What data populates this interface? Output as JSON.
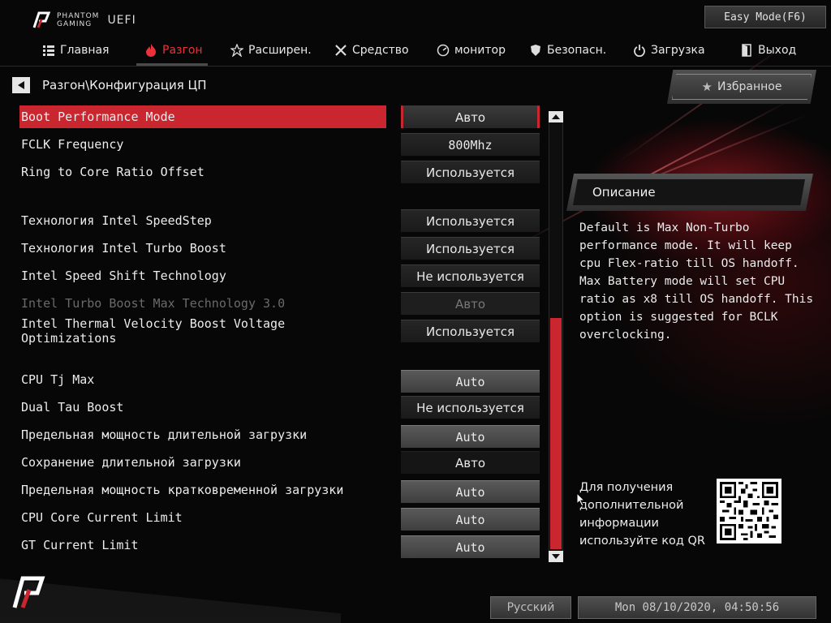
{
  "header": {
    "brand_line1": "PHANTOM",
    "brand_line2": "GAMING",
    "brand_uefi": "UEFI",
    "easy_mode_label": "Easy Mode(F6)"
  },
  "nav": {
    "tabs": [
      {
        "label": "Главная",
        "icon": "grid-icon",
        "active": false
      },
      {
        "label": "Разгон",
        "icon": "flame-icon",
        "active": true
      },
      {
        "label": "Расширен.",
        "icon": "star-icon",
        "active": false
      },
      {
        "label": "Средство",
        "icon": "tools-icon",
        "active": false
      },
      {
        "label": "монитор",
        "icon": "monitor-icon",
        "active": false
      },
      {
        "label": "Безопасн.",
        "icon": "shield-icon",
        "active": false
      },
      {
        "label": "Загрузка",
        "icon": "power-icon",
        "active": false
      },
      {
        "label": "Выход",
        "icon": "exit-icon",
        "active": false
      }
    ]
  },
  "breadcrumb": "Разгон\\Конфигурация ЦП",
  "favorites_label": "Избранное",
  "settings": [
    {
      "label": "Boot Performance Mode",
      "value": "Авто",
      "style": "sel",
      "selected": true
    },
    {
      "label": "FCLK Frequency",
      "value": "800Mhz",
      "style": "mono"
    },
    {
      "label": "Ring to Core Ratio Offset",
      "value": "Используется",
      "style": "normal"
    },
    {
      "label": "Технология Intel SpeedStep",
      "value": "Используется",
      "style": "normal"
    },
    {
      "label": "Технология Intel Turbo Boost",
      "value": "Используется",
      "style": "normal"
    },
    {
      "label": "Intel Speed Shift Technology",
      "value": "Не используется",
      "style": "normal"
    },
    {
      "label": "Intel Turbo Boost Max Technology 3.0",
      "value": "Авто",
      "style": "disabled",
      "disabled": true
    },
    {
      "label": "Intel Thermal Velocity Boost Voltage Optimizations",
      "value": "Используется",
      "style": "normal"
    },
    {
      "label": "CPU Tj Max",
      "value": "Auto",
      "style": "light"
    },
    {
      "label": "Dual Tau Boost",
      "value": "Не используется",
      "style": "normal"
    },
    {
      "label": "Предельная мощность длительной загрузки",
      "value": "Auto",
      "style": "light"
    },
    {
      "label": "Сохранение длительной загрузки",
      "value": "Авто",
      "style": "dark"
    },
    {
      "label": "Предельная мощность кратковременной загрузки",
      "value": "Auto",
      "style": "light"
    },
    {
      "label": "CPU Core Current Limit",
      "value": "Auto",
      "style": "light"
    },
    {
      "label": "GT Current Limit",
      "value": "Auto",
      "style": "light"
    }
  ],
  "description": {
    "title": "Описание",
    "text": "Default is Max Non-Turbo\nperformance mode. It will keep\ncpu Flex-ratio till OS handoff.\nMax Battery mode will set CPU\nratio as x8 till OS handoff. This\noption is suggested for BCLK\noverclocking."
  },
  "qr_text": "Для получения\nдополнительной\nинформации\nиспользуйте код QR",
  "footer": {
    "language": "Русский",
    "datetime": "Mon 08/10/2020, 04:50:56"
  },
  "colors": {
    "accent": "#c9262f",
    "active_tab": "#e8323c",
    "background": "#070707"
  }
}
